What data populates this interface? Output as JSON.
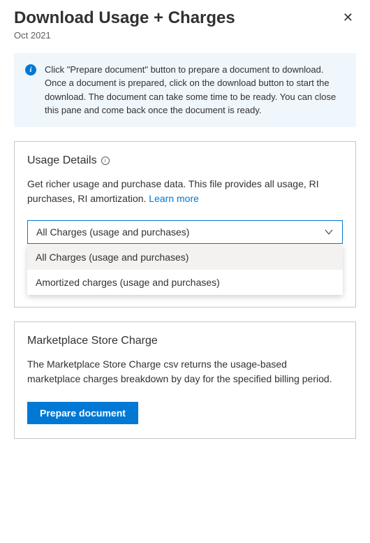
{
  "header": {
    "title": "Download Usage + Charges",
    "subtitle": "Oct 2021"
  },
  "info_banner": {
    "text": "Click \"Prepare document\" button to prepare a document to download. Once a document is prepared, click on the download button to start the download. The document can take some time to be ready. You can close this pane and come back once the document is ready."
  },
  "usage_details": {
    "title": "Usage Details",
    "description": "Get richer usage and purchase data. This file provides all usage, RI purchases, RI amortization. ",
    "learn_more": "Learn more",
    "dropdown": {
      "selected": "All Charges (usage and purchases)",
      "options": [
        "All Charges (usage and purchases)",
        "Amortized charges (usage and purchases)"
      ]
    }
  },
  "marketplace": {
    "title": "Marketplace Store Charge",
    "description": "The Marketplace Store Charge csv returns the usage-based marketplace charges breakdown by day for the specified billing period.",
    "button": "Prepare document"
  }
}
